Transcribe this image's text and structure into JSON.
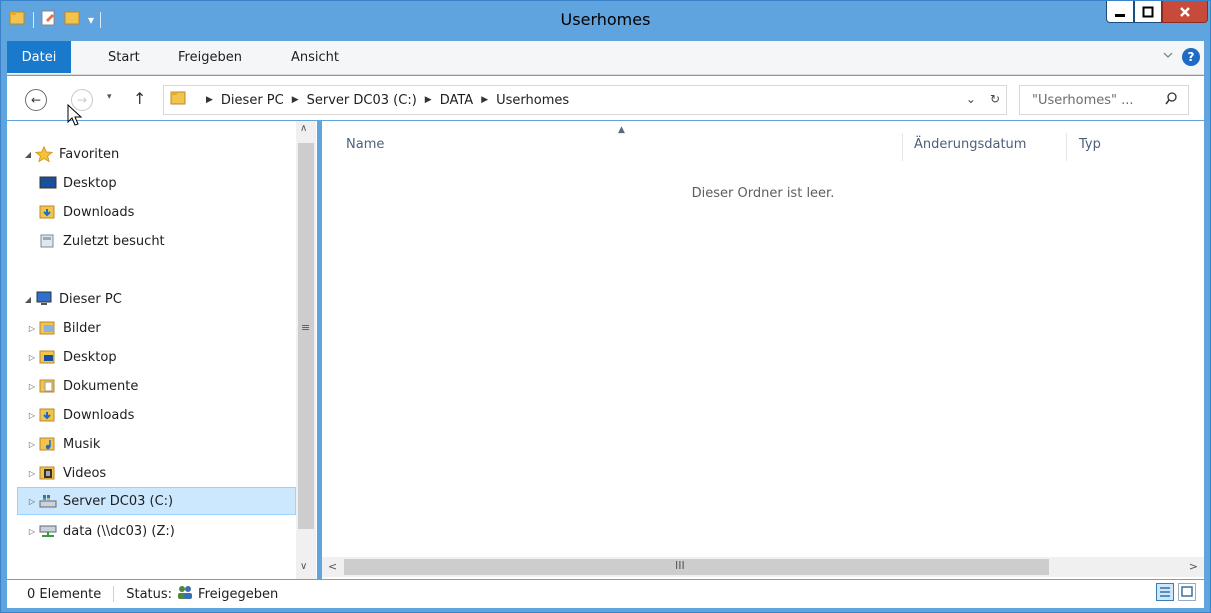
{
  "window": {
    "title": "Userhomes",
    "qat_dropdown": "▾"
  },
  "ribbon": {
    "tabs": [
      "Datei",
      "Start",
      "Freigeben",
      "Ansicht"
    ],
    "help": "?"
  },
  "nav": {
    "back": "←",
    "forward": "→",
    "recent": "▾",
    "up": "↑",
    "breadcrumb": [
      "Dieser PC",
      "Server DC03 (C:)",
      "DATA",
      "Userhomes"
    ],
    "address_dropdown": "⌄",
    "refresh": "↻",
    "search_placeholder": "\"Userhomes\" ..."
  },
  "tree": {
    "favorites": {
      "label": "Favoriten",
      "items": [
        "Desktop",
        "Downloads",
        "Zuletzt besucht"
      ]
    },
    "this_pc": {
      "label": "Dieser PC",
      "items": [
        "Bilder",
        "Desktop",
        "Dokumente",
        "Downloads",
        "Musik",
        "Videos",
        "Server DC03 (C:)",
        "data (\\\\dc03) (Z:)"
      ]
    },
    "selected": "Server DC03 (C:)"
  },
  "content": {
    "columns": [
      "Name",
      "Änderungsdatum",
      "Typ"
    ],
    "empty_message": "Dieser Ordner ist leer."
  },
  "status": {
    "count": "0 Elemente",
    "share_label": "Status:",
    "share_value": "Freigegeben"
  },
  "colors": {
    "titlebar": "#5fa3df",
    "file_tab": "#1979ca",
    "selection": "#cce8ff",
    "close_button": "#c74a3b"
  }
}
